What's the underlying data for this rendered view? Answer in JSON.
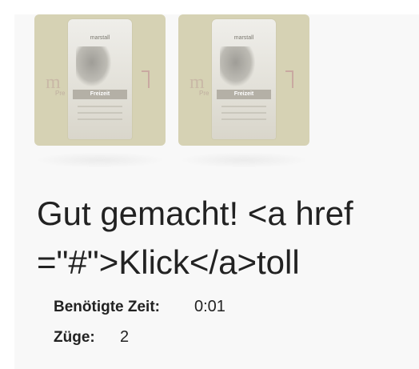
{
  "cards": [
    {
      "brand": "marstall",
      "logo_letter": "m",
      "logo_text": "Pre",
      "product": "Freizeit"
    },
    {
      "brand": "marstall",
      "logo_letter": "m",
      "logo_text": "Pre",
      "product": "Freizeit"
    }
  ],
  "result": {
    "headline": "Gut gemacht! <a href=\"#\">Klick</a>toll"
  },
  "stats": {
    "time_label": "Benötigte Zeit:",
    "time_value": "0:01",
    "moves_label": "Züge:",
    "moves_value": "2"
  }
}
